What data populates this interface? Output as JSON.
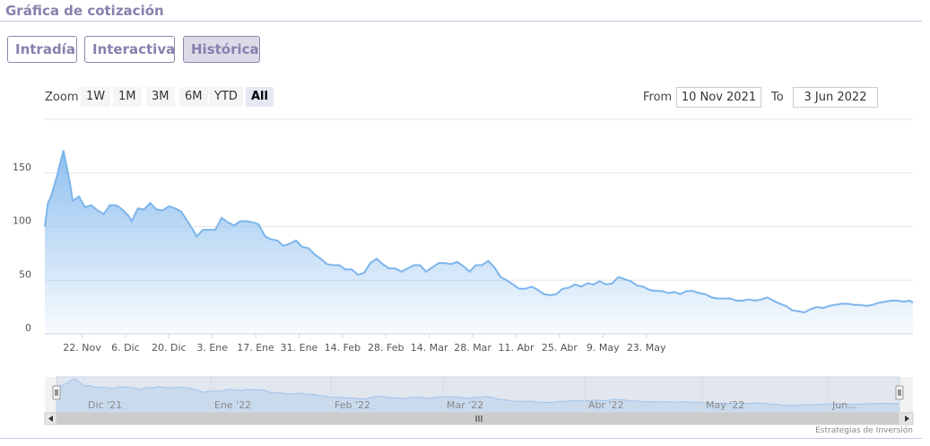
{
  "header": {
    "title": "Gráfica de cotización"
  },
  "tabs": [
    {
      "label": "Intradía",
      "active": false
    },
    {
      "label": "Interactiva",
      "active": false
    },
    {
      "label": "Histórica",
      "active": true
    }
  ],
  "range_selector": {
    "zoom_label": "Zoom",
    "buttons": [
      "1W",
      "1M",
      "3M",
      "6M",
      "YTD",
      "All"
    ],
    "active": "All",
    "from_label": "From",
    "from_value": "10 Nov 2021",
    "to_label": "To",
    "to_value": "3 Jun 2022"
  },
  "credits": "Estrategias de Inversión",
  "colors": {
    "line": "#7cb5ec",
    "accent": "#8a7fae",
    "navigator_fill": "#ccd6eb"
  },
  "chart_data": {
    "type": "area",
    "title": "",
    "xlabel": "",
    "ylabel": "",
    "x_tick_labels": [
      "22. Nov",
      "6. Dic",
      "20. Dic",
      "3. Ene",
      "17. Ene",
      "31. Ene",
      "14. Feb",
      "28. Feb",
      "14. Mar",
      "28. Mar",
      "11. Abr",
      "25. Abr",
      "9. May",
      "23. May"
    ],
    "y_tick_labels": [
      "0",
      "50",
      "100",
      "150"
    ],
    "ylim": [
      0,
      200
    ],
    "grid": true,
    "navigator_labels": [
      "Dic '21",
      "Ene '22",
      "Feb '22",
      "Mar '22",
      "Abr '22",
      "May '22",
      "Jun..."
    ],
    "series": [
      {
        "values": [
          [
            "2021-11-10",
            100
          ],
          [
            "2021-11-11",
            122
          ],
          [
            "2021-11-12",
            128
          ],
          [
            "2021-11-14",
            148
          ],
          [
            "2021-11-16",
            171
          ],
          [
            "2021-11-18",
            142
          ],
          [
            "2021-11-19",
            124
          ],
          [
            "2021-11-21",
            128
          ],
          [
            "2021-11-23",
            118
          ],
          [
            "2021-11-25",
            120
          ],
          [
            "2021-11-27",
            115
          ],
          [
            "2021-11-29",
            112
          ],
          [
            "2021-12-01",
            120
          ],
          [
            "2021-12-03",
            120
          ],
          [
            "2021-12-05",
            116
          ],
          [
            "2021-12-07",
            110
          ],
          [
            "2021-12-08",
            105
          ],
          [
            "2021-12-10",
            117
          ],
          [
            "2021-12-12",
            116
          ],
          [
            "2021-12-14",
            122
          ],
          [
            "2021-12-16",
            116
          ],
          [
            "2021-12-18",
            115
          ],
          [
            "2021-12-20",
            119
          ],
          [
            "2021-12-22",
            117
          ],
          [
            "2021-12-24",
            114
          ],
          [
            "2021-12-26",
            105
          ],
          [
            "2021-12-28",
            96
          ],
          [
            "2021-12-29",
            91
          ],
          [
            "2021-12-31",
            97
          ],
          [
            "2022-01-02",
            97
          ],
          [
            "2022-01-04",
            97
          ],
          [
            "2022-01-06",
            108
          ],
          [
            "2022-01-08",
            104
          ],
          [
            "2022-01-10",
            101
          ],
          [
            "2022-01-12",
            105
          ],
          [
            "2022-01-14",
            105
          ],
          [
            "2022-01-16",
            104
          ],
          [
            "2022-01-18",
            102
          ],
          [
            "2022-01-20",
            91
          ],
          [
            "2022-01-22",
            88
          ],
          [
            "2022-01-24",
            87
          ],
          [
            "2022-01-26",
            82
          ],
          [
            "2022-01-28",
            84
          ],
          [
            "2022-01-30",
            87
          ],
          [
            "2022-02-01",
            81
          ],
          [
            "2022-02-03",
            80
          ],
          [
            "2022-02-05",
            74
          ],
          [
            "2022-02-07",
            70
          ],
          [
            "2022-02-09",
            65
          ],
          [
            "2022-02-11",
            64
          ],
          [
            "2022-02-13",
            64
          ],
          [
            "2022-02-15",
            60
          ],
          [
            "2022-02-17",
            60
          ],
          [
            "2022-02-19",
            55
          ],
          [
            "2022-02-21",
            57
          ],
          [
            "2022-02-23",
            66
          ],
          [
            "2022-02-25",
            70
          ],
          [
            "2022-02-27",
            65
          ],
          [
            "2022-03-01",
            61
          ],
          [
            "2022-03-03",
            61
          ],
          [
            "2022-03-05",
            58
          ],
          [
            "2022-03-07",
            61
          ],
          [
            "2022-03-09",
            64
          ],
          [
            "2022-03-11",
            64
          ],
          [
            "2022-03-13",
            58
          ],
          [
            "2022-03-15",
            62
          ],
          [
            "2022-03-17",
            66
          ],
          [
            "2022-03-19",
            66
          ],
          [
            "2022-03-21",
            65
          ],
          [
            "2022-03-23",
            67
          ],
          [
            "2022-03-25",
            63
          ],
          [
            "2022-03-27",
            58
          ],
          [
            "2022-03-29",
            64
          ],
          [
            "2022-03-31",
            64
          ],
          [
            "2022-04-02",
            68
          ],
          [
            "2022-04-04",
            62
          ],
          [
            "2022-04-06",
            53
          ],
          [
            "2022-04-08",
            50
          ],
          [
            "2022-04-10",
            46
          ],
          [
            "2022-04-12",
            42
          ],
          [
            "2022-04-14",
            42
          ],
          [
            "2022-04-16",
            44
          ],
          [
            "2022-04-18",
            41
          ],
          [
            "2022-04-20",
            37
          ],
          [
            "2022-04-22",
            36
          ],
          [
            "2022-04-24",
            37
          ],
          [
            "2022-04-26",
            42
          ],
          [
            "2022-04-28",
            43
          ],
          [
            "2022-04-30",
            46
          ],
          [
            "2022-05-02",
            44
          ],
          [
            "2022-05-04",
            47
          ],
          [
            "2022-05-06",
            46
          ],
          [
            "2022-05-08",
            49
          ],
          [
            "2022-05-10",
            46
          ],
          [
            "2022-05-12",
            47
          ],
          [
            "2022-05-14",
            53
          ],
          [
            "2022-05-16",
            51
          ],
          [
            "2022-05-18",
            49
          ],
          [
            "2022-05-20",
            45
          ],
          [
            "2022-05-22",
            44
          ],
          [
            "2022-05-24",
            41
          ],
          [
            "2022-05-26",
            40
          ],
          [
            "2022-05-28",
            40
          ],
          [
            "2022-05-30",
            38
          ],
          [
            "2022-06-01",
            39
          ],
          [
            "2022-06-03",
            37
          ],
          [
            "2022-06-05",
            40
          ],
          [
            "2022-06-07",
            40
          ],
          [
            "2022-06-09",
            38
          ],
          [
            "2022-06-11",
            37
          ],
          [
            "2022-06-13",
            34
          ],
          [
            "2022-06-15",
            33
          ],
          [
            "2022-06-17",
            33
          ],
          [
            "2022-06-19",
            33
          ],
          [
            "2022-06-21",
            31
          ],
          [
            "2022-06-23",
            31
          ],
          [
            "2022-06-25",
            32
          ],
          [
            "2022-06-27",
            31
          ],
          [
            "2022-06-29",
            32
          ],
          [
            "2022-07-01",
            34
          ],
          [
            "2022-07-03",
            31
          ],
          [
            "2022-07-05",
            28
          ],
          [
            "2022-07-07",
            26
          ],
          [
            "2022-07-09",
            22
          ],
          [
            "2022-07-11",
            21
          ],
          [
            "2022-07-13",
            20
          ],
          [
            "2022-07-15",
            23
          ],
          [
            "2022-07-17",
            25
          ],
          [
            "2022-07-19",
            24
          ],
          [
            "2022-07-21",
            26
          ],
          [
            "2022-07-23",
            27
          ],
          [
            "2022-07-25",
            28
          ],
          [
            "2022-07-27",
            28
          ],
          [
            "2022-07-29",
            27
          ],
          [
            "2022-07-31",
            27
          ],
          [
            "2022-08-02",
            26
          ],
          [
            "2022-08-04",
            27
          ],
          [
            "2022-08-06",
            29
          ],
          [
            "2022-08-08",
            30
          ],
          [
            "2022-08-10",
            31
          ],
          [
            "2022-08-12",
            31
          ],
          [
            "2022-08-14",
            30
          ],
          [
            "2022-08-16",
            31
          ],
          [
            "2022-08-17",
            29
          ]
        ]
      }
    ]
  }
}
